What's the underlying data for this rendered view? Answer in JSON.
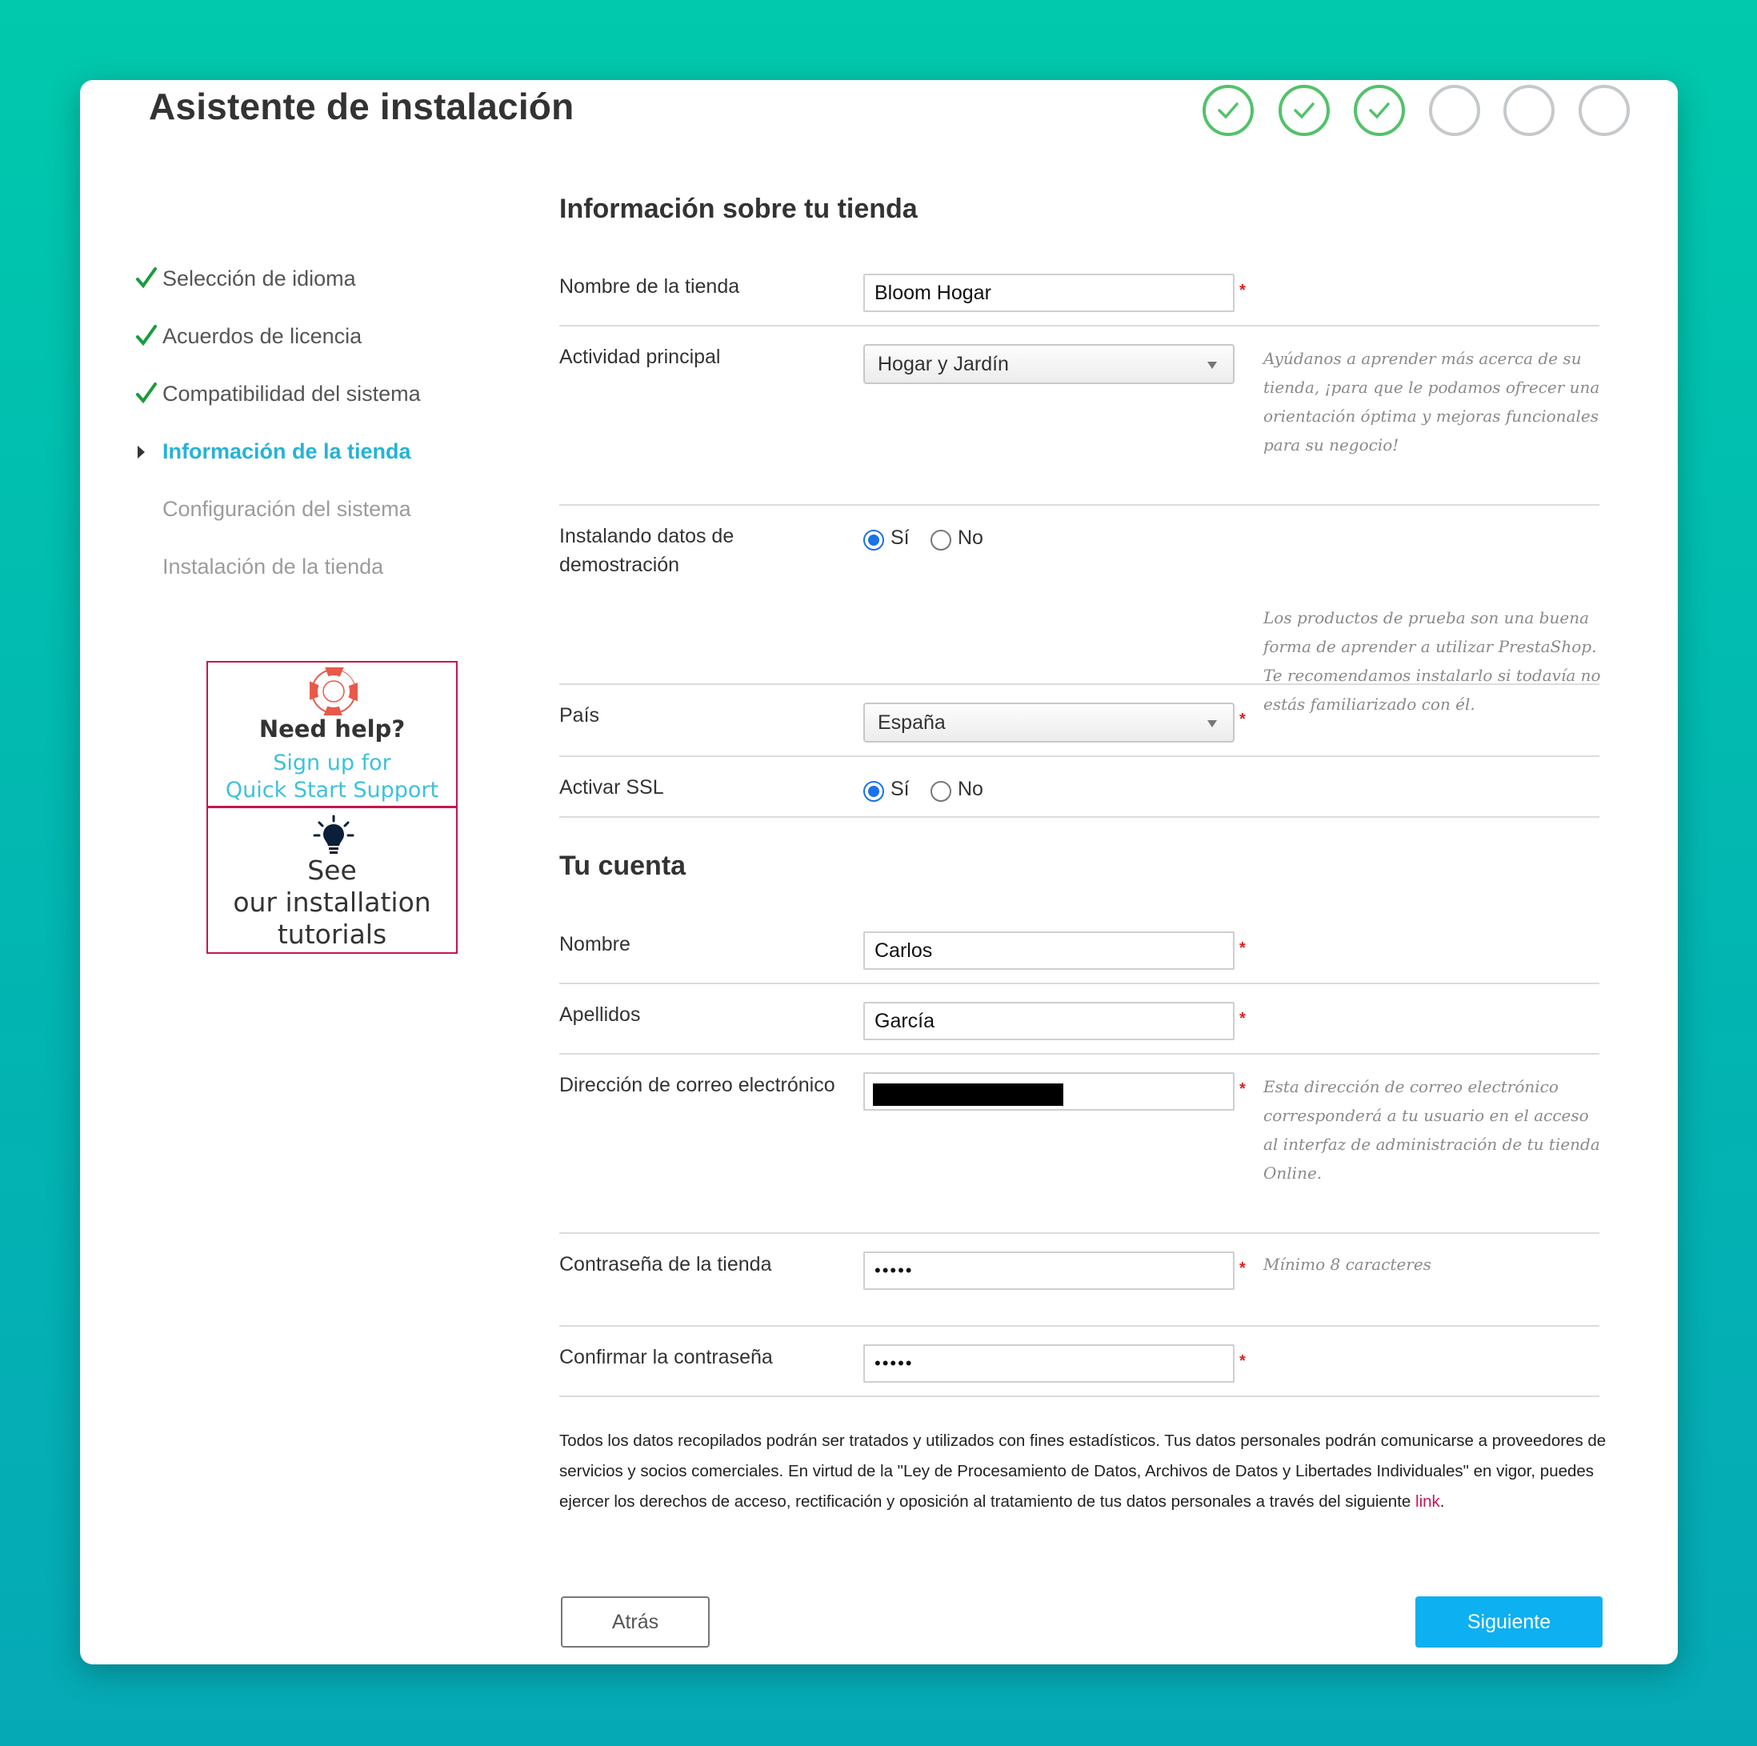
{
  "window": {
    "title": "Asistente de instalación"
  },
  "progress": {
    "steps_total": 6,
    "steps_done": 3
  },
  "sidebar": {
    "items": [
      {
        "label": "Selección de idioma",
        "state": "done"
      },
      {
        "label": "Acuerdos de licencia",
        "state": "done"
      },
      {
        "label": "Compatibilidad del sistema",
        "state": "done"
      },
      {
        "label": "Información de la tienda",
        "state": "active"
      },
      {
        "label": "Configuración del sistema",
        "state": "pending"
      },
      {
        "label": "Instalación de la tienda",
        "state": "pending"
      }
    ]
  },
  "help": {
    "title": "Need help?",
    "link_line1": "Sign up for",
    "link_line2": "Quick Start Support",
    "tutorials_line1": "See",
    "tutorials_line2": "our installation",
    "tutorials_line3": "tutorials"
  },
  "store_section": {
    "title": "Información sobre tu tienda",
    "store_name": {
      "label": "Nombre de la tienda",
      "value": "Bloom Hogar"
    },
    "activity": {
      "label": "Actividad principal",
      "selected": "Hogar y Jardín",
      "hint": "Ayúdanos a aprender más acerca de su tienda, ¡para que le podamos ofrecer una orientación óptima y mejoras funcionales para su negocio!"
    },
    "demo_data": {
      "label": "Instalando datos de demostración",
      "yes": "Sí",
      "no": "No",
      "selected": "yes",
      "hint": "Los productos de prueba son una buena forma de aprender a utilizar PrestaShop. Te recomendamos instalarlo si todavía no estás familiarizado con él."
    },
    "country": {
      "label": "País",
      "selected": "España"
    },
    "ssl": {
      "label": "Activar SSL",
      "yes": "Sí",
      "no": "No",
      "selected": "yes"
    }
  },
  "account_section": {
    "title": "Tu cuenta",
    "first_name": {
      "label": "Nombre",
      "value": "Carlos"
    },
    "last_name": {
      "label": "Apellidos",
      "value": "García"
    },
    "email": {
      "label": "Dirección de correo electrónico",
      "value_redacted": true,
      "hint": "Esta dirección de correo electrónico corresponderá a tu usuario en el acceso al interfaz de administración de tu tienda Online."
    },
    "password": {
      "label": "Contraseña de la tienda",
      "value": "•••••",
      "hint": "Mínimo 8 caracteres"
    },
    "confirm_password": {
      "label": "Confirmar la contraseña",
      "value": "•••••"
    }
  },
  "required_marker": "*",
  "legal": {
    "text": "Todos los datos recopilados podrán ser tratados y utilizados con fines estadísticos. Tus datos personales podrán comunicarse a proveedores de servicios y socios comerciales. En virtud de la \"Ley de Procesamiento de Datos, Archivos de Datos y Libertades Individuales\" en vigor, puedes ejercer los derechos de acceso, rectificación y oposición al tratamiento de tus datos personales a través del siguiente ",
    "link_text": "link",
    "suffix": "."
  },
  "buttons": {
    "back": "Atrás",
    "next": "Siguiente"
  },
  "colors": {
    "background_top": "#00c9ad",
    "background_bottom": "#05a9b6",
    "step_done": "#52c26b",
    "step_pending": "#c5c9cc",
    "active_nav": "#25b3d6",
    "done_check": "#1a9c3e",
    "help_border": "#c2194d",
    "required": "#e02020",
    "link": "#c2185b",
    "primary_button": "#0db0f0"
  },
  "icons": {
    "step_done": "check-icon",
    "nav_done": "check-icon",
    "nav_current": "caret-right-icon",
    "help": "lifebuoy-icon",
    "tutorials": "lightbulb-icon",
    "select": "chevron-down-icon"
  }
}
